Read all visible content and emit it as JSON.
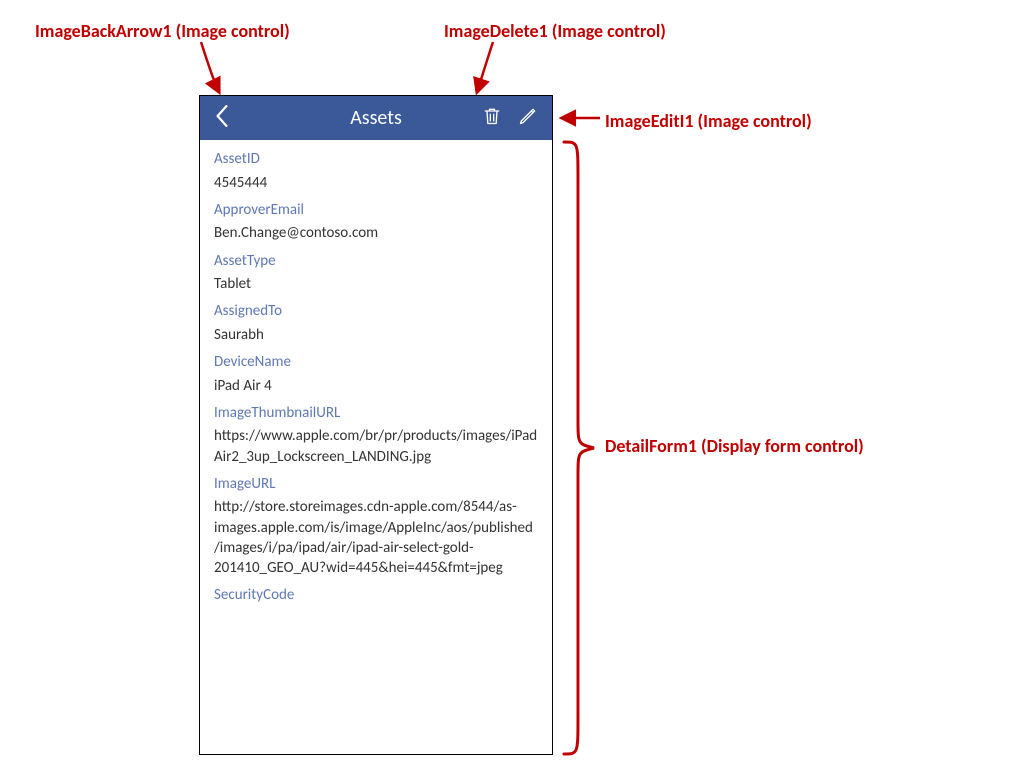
{
  "annotations": {
    "back_arrow": "ImageBackArrow1 (Image control)",
    "delete": "ImageDelete1 (Image control)",
    "edit": "ImageEditI1 (Image control)",
    "detail_form": "DetailForm1 (Display form control)"
  },
  "header": {
    "title": "Assets"
  },
  "fields": [
    {
      "label": "AssetID",
      "value": "4545444"
    },
    {
      "label": "ApproverEmail",
      "value": "Ben.Change@contoso.com"
    },
    {
      "label": "AssetType",
      "value": "Tablet"
    },
    {
      "label": "AssignedTo",
      "value": "Saurabh"
    },
    {
      "label": "DeviceName",
      "value": "iPad Air 4"
    },
    {
      "label": "ImageThumbnailURL",
      "value": "https://www.apple.com/br/pr/products/images/iPadAir2_3up_Lockscreen_LANDING.jpg"
    },
    {
      "label": "ImageURL",
      "value": "http://store.storeimages.cdn-apple.com/8544/as-images.apple.com/is/image/AppleInc/aos/published/images/i/pa/ipad/air/ipad-air-select-gold-201410_GEO_AU?wid=445&hei=445&fmt=jpeg"
    },
    {
      "label": "SecurityCode",
      "value": ""
    }
  ],
  "colors": {
    "annotation": "#c00000",
    "header_bg": "#3b5998",
    "field_label": "#5e78b3"
  }
}
